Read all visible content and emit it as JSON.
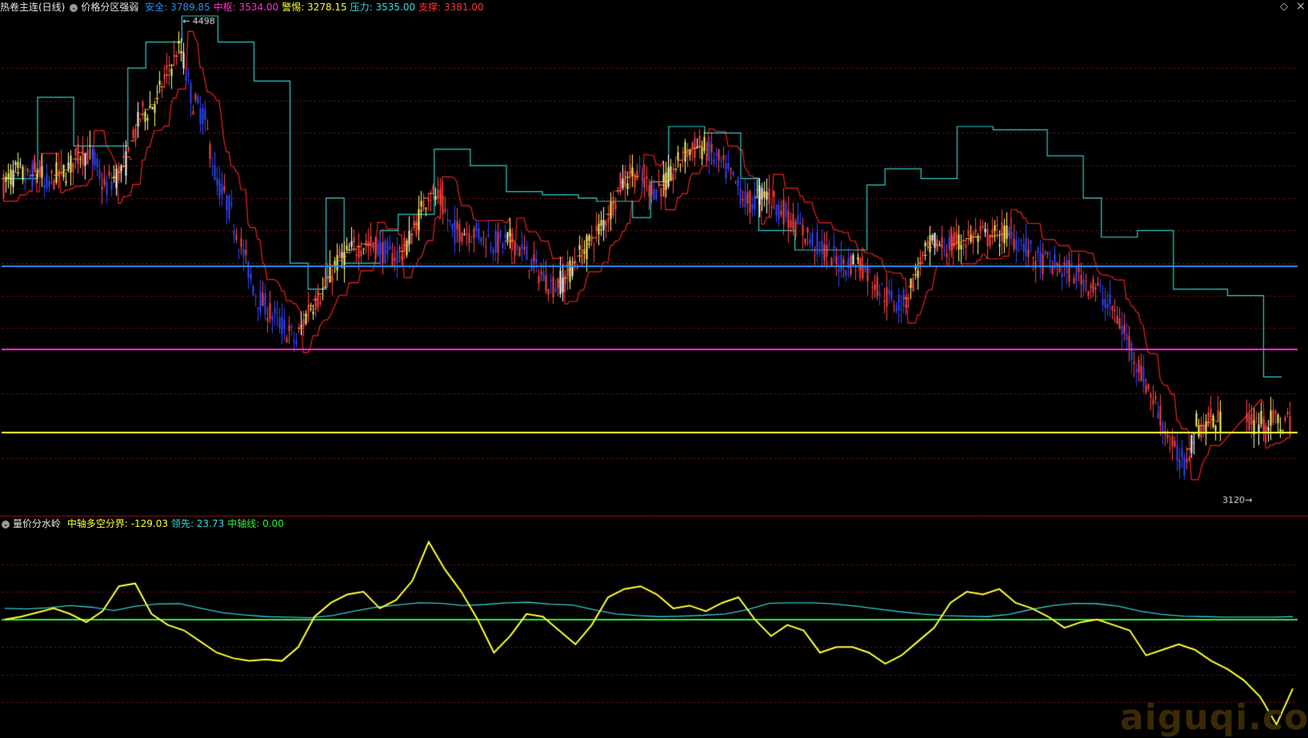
{
  "top_panel": {
    "title": "热卷主连(日线)",
    "indicator_name": "价格分区强弱",
    "values": [
      {
        "label": "安全:",
        "value": "3789.85",
        "color": "#2d8ef0"
      },
      {
        "label": "中枢:",
        "value": "3534.00",
        "color": "#ff33cc"
      },
      {
        "label": "警惕:",
        "value": "3278.15",
        "color": "#ffff33"
      },
      {
        "label": "压力:",
        "value": "3535.00",
        "color": "#33dddd"
      },
      {
        "label": "支撑:",
        "value": "3381.00",
        "color": "#ff3333"
      }
    ],
    "high_label": "4498",
    "low_label": "3120"
  },
  "bottom_panel": {
    "indicator_name": "量价分水岭",
    "values": [
      {
        "label": "中轴多空分界:",
        "value": "-129.03",
        "color": "#ffff33"
      },
      {
        "label": "领先:",
        "value": "23.73",
        "color": "#33dddd"
      },
      {
        "label": "中轴线:",
        "value": "0.00",
        "color": "#33ee33"
      }
    ]
  },
  "icons": {
    "settings": "diamond-icon",
    "close": "close-icon",
    "collapse": "circle-arrow-icon"
  },
  "watermark": "aiguqi.com",
  "chart_data": [
    {
      "type": "line",
      "title": "价格分区强弱",
      "ylim": [
        3050,
        4560
      ],
      "levels": [
        {
          "name": "安全",
          "value": 3789.85,
          "color": "#2d8ef0"
        },
        {
          "name": "中枢",
          "value": 3534.0,
          "color": "#ff33cc"
        },
        {
          "name": "警惕",
          "value": 3278.15,
          "color": "#ffff33"
        }
      ],
      "x_index": [
        0,
        20,
        35,
        50,
        55,
        70,
        85,
        100,
        115,
        130,
        145,
        158,
        175,
        195,
        210,
        225,
        240,
        255,
        270,
        285,
        300,
        320,
        340,
        355,
        370,
        385,
        405,
        420,
        440,
        455,
        470,
        490,
        505,
        520,
        535,
        550,
        565,
        580,
        600,
        620,
        640,
        655,
        670,
        690,
        705,
        720,
        740,
        760,
        775,
        790,
        808,
        820,
        838,
        855,
        875,
        895,
        915,
        935,
        955,
        970,
        990,
        1010,
        1030,
        1050,
        1075,
        1090,
        1110,
        1130,
        1150,
        1165,
        1180,
        1195,
        1215,
        1235,
        1255,
        1275,
        1295,
        1310,
        1330,
        1350,
        1370,
        1390,
        1410,
        1430,
        1450,
        1465,
        1480,
        1495,
        1505,
        1515,
        1525,
        1535,
        1545,
        1555
      ],
      "close": [
        4030,
        4080,
        4060,
        4090,
        4030,
        4070,
        4090,
        4140,
        4130,
        4030,
        4070,
        4110,
        4250,
        4300,
        4390,
        4460,
        4300,
        4250,
        4050,
        3980,
        3860,
        3700,
        3640,
        3600,
        3560,
        3660,
        3720,
        3800,
        3840,
        3860,
        3850,
        3820,
        3840,
        3920,
        4020,
        3990,
        3900,
        3900,
        3890,
        3860,
        3870,
        3830,
        3780,
        3730,
        3750,
        3810,
        3870,
        3950,
        4040,
        4080,
        4040,
        4030,
        4060,
        4140,
        4160,
        4120,
        4060,
        3980,
        4020,
        3980,
        3930,
        3880,
        3840,
        3800,
        3800,
        3750,
        3690,
        3680,
        3800,
        3860,
        3850,
        3860,
        3880,
        3880,
        3890,
        3870,
        3810,
        3800,
        3780,
        3760,
        3720,
        3660,
        3560,
        3440,
        3330,
        3230,
        3180,
        3300,
        3300,
        3320,
        3310
      ],
      "leading_line": [
        4060,
        4060,
        4310,
        4310,
        4160,
        4160,
        4160,
        4400,
        4480,
        4480,
        4560,
        4560,
        4480,
        4480,
        4360,
        4360,
        3800,
        3720,
        4000,
        3800,
        3800,
        3900,
        3950,
        3950,
        4150,
        4150,
        4100,
        4100,
        4020,
        4020,
        4010,
        4010,
        4000,
        3990,
        3990,
        3940,
        4050,
        4220,
        4220,
        4200,
        4200,
        4060,
        3900,
        3900,
        3840,
        3840,
        3840,
        3840,
        4040,
        4090,
        4090,
        4060,
        4060,
        4220,
        4220,
        4210,
        4210,
        4210,
        4130,
        4130,
        4000,
        3880,
        3880,
        3900,
        3900,
        3720,
        3720,
        3720,
        3700,
        3700,
        3450,
        3450
      ]
    },
    {
      "type": "line",
      "title": "量价分水岭",
      "ylim": [
        -420,
        320
      ],
      "series": [
        {
          "name": "中轴多空分界",
          "color": "#ffff33",
          "values": [
            0,
            10,
            25,
            40,
            20,
            -10,
            30,
            120,
            130,
            20,
            -20,
            -40,
            -80,
            -120,
            -140,
            -150,
            -145,
            -150,
            -100,
            10,
            60,
            90,
            100,
            40,
            70,
            140,
            280,
            180,
            100,
            0,
            -120,
            -60,
            20,
            10,
            -40,
            -90,
            -20,
            80,
            110,
            120,
            90,
            40,
            50,
            30,
            60,
            80,
            0,
            -60,
            -20,
            -40,
            -120,
            -100,
            -100,
            -120,
            -160,
            -130,
            -80,
            -30,
            60,
            100,
            90,
            110,
            60,
            40,
            10,
            -30,
            -10,
            0,
            -20,
            -40,
            -130,
            -110,
            -90,
            -110,
            -150,
            -180,
            -220,
            -280,
            -380,
            -250
          ]
        },
        {
          "name": "领先",
          "color": "#33dddd",
          "values": [
            40,
            38,
            42,
            50,
            44,
            32,
            48,
            56,
            57,
            40,
            24,
            16,
            10,
            8,
            6,
            14,
            30,
            44,
            52,
            60,
            58,
            50,
            54,
            60,
            62,
            55,
            52,
            35,
            20,
            14,
            10,
            12,
            15,
            20,
            35,
            58,
            60,
            60,
            56,
            48,
            38,
            28,
            20,
            14,
            12,
            10,
            18,
            36,
            50,
            58,
            57,
            48,
            30,
            18,
            12,
            10,
            8,
            8,
            8,
            10
          ]
        },
        {
          "name": "中轴线",
          "color": "#33ee33",
          "values": [
            0
          ]
        }
      ]
    }
  ]
}
